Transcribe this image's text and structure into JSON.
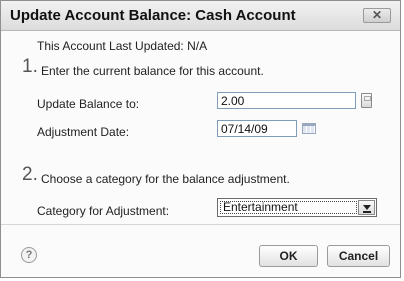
{
  "dialog": {
    "title": "Update Account Balance: Cash Account",
    "close_label": "✕"
  },
  "last_updated": "This Account Last Updated: N/A",
  "step1": {
    "number": "1.",
    "instruction": "Enter the current balance for this account.",
    "balance_label": "Update Balance to:",
    "balance_value": "2.00",
    "date_label": "Adjustment Date:",
    "date_value": "07/14/09"
  },
  "step2": {
    "number": "2.",
    "instruction": "Choose a category for the balance adjustment.",
    "category_label": "Category for Adjustment:",
    "category_value": "Entertainment"
  },
  "footer": {
    "help_label": "?",
    "ok_label": "OK",
    "cancel_label": "Cancel"
  }
}
